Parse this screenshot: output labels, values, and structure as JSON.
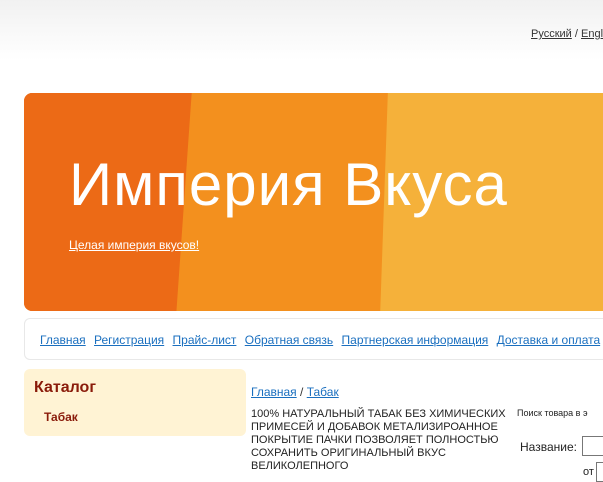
{
  "header": {
    "lang_ru": "Русский",
    "lang_sep": "/",
    "lang_en": "Engli"
  },
  "banner": {
    "title": "Империя Вкуса",
    "tagline": "Целая империя вкусов!"
  },
  "nav": {
    "items": [
      "Главная",
      "Регистрация",
      "Прайс-лист",
      "Обратная связь",
      "Партнерская информация",
      "Доставка и оплата"
    ]
  },
  "catalog": {
    "title": "Каталог",
    "items": [
      "Табак"
    ]
  },
  "breadcrumb": {
    "home": "Главная",
    "sep": "/",
    "current": "Табак"
  },
  "product": {
    "description": "100% НАТУРАЛЬНЫЙ ТАБАК БЕЗ ХИМИЧЕСКИХ ПРИМЕСЕЙ И ДОБАВОК МЕТАЛИЗИРОАННОЕ ПОКРЫТИЕ ПАЧКИ ПОЗВОЛЯЕТ ПОЛНОСТЬЮ СОХРАНИТЬ ОРИГИНАЛЬНЫЙ ВКУС ВЕЛИКОЛЕПНОГО"
  },
  "search": {
    "title": "Поиск товара в э",
    "name_label": "Название:",
    "from_label": "от"
  }
}
